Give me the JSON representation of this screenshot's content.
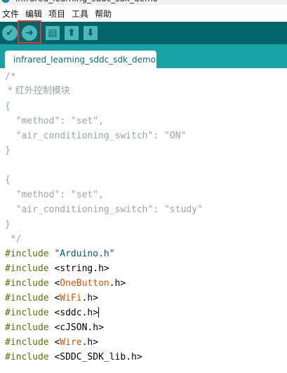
{
  "window": {
    "title": "infrared_learning_sddc_sdk_demo"
  },
  "menu": {
    "items": [
      "文件",
      "编辑",
      "项目",
      "工具",
      "帮助"
    ]
  },
  "toolbar": {
    "verify": "✔",
    "upload": "➜",
    "new": "▤",
    "open": "⬆",
    "save": "⬇",
    "highlight_color": "#e5332a"
  },
  "tabs": [
    {
      "label": "infrared_learning_sddc_sdk_demo"
    }
  ],
  "code": {
    "l1": "/*",
    "l2": " * 红外控制模块",
    "l3": "{",
    "l4": "  \"method\": \"set\",",
    "l5": "  \"air_conditioning_switch\": \"ON\"",
    "l6": "}",
    "l8": "{",
    "l9": "  \"method\": \"set\",",
    "l10": "  \"air_conditioning_switch\": \"study\"",
    "l11": "}",
    "l12": " */",
    "includes": [
      {
        "directive": "#include",
        "open": "\"",
        "name": "Arduino.h",
        "close": "\""
      },
      {
        "directive": "#include",
        "open": "<",
        "name": "string.h",
        "close": ">"
      },
      {
        "directive": "#include",
        "open": "<",
        "name": "OneButton",
        "close": ".h>"
      },
      {
        "directive": "#include",
        "open": "<",
        "name": "WiFi",
        "close": ".h>"
      },
      {
        "directive": "#include",
        "open": "<",
        "name": "sddc.h",
        "close": ">"
      },
      {
        "directive": "#include",
        "open": "<",
        "name": "cJSON.h",
        "close": ">"
      },
      {
        "directive": "#include",
        "open": "<",
        "name": "Wire",
        "close": ".h>"
      },
      {
        "directive": "#include",
        "open": "<",
        "name": "SDDC_SDK_lib.h",
        "close": ">"
      }
    ]
  }
}
